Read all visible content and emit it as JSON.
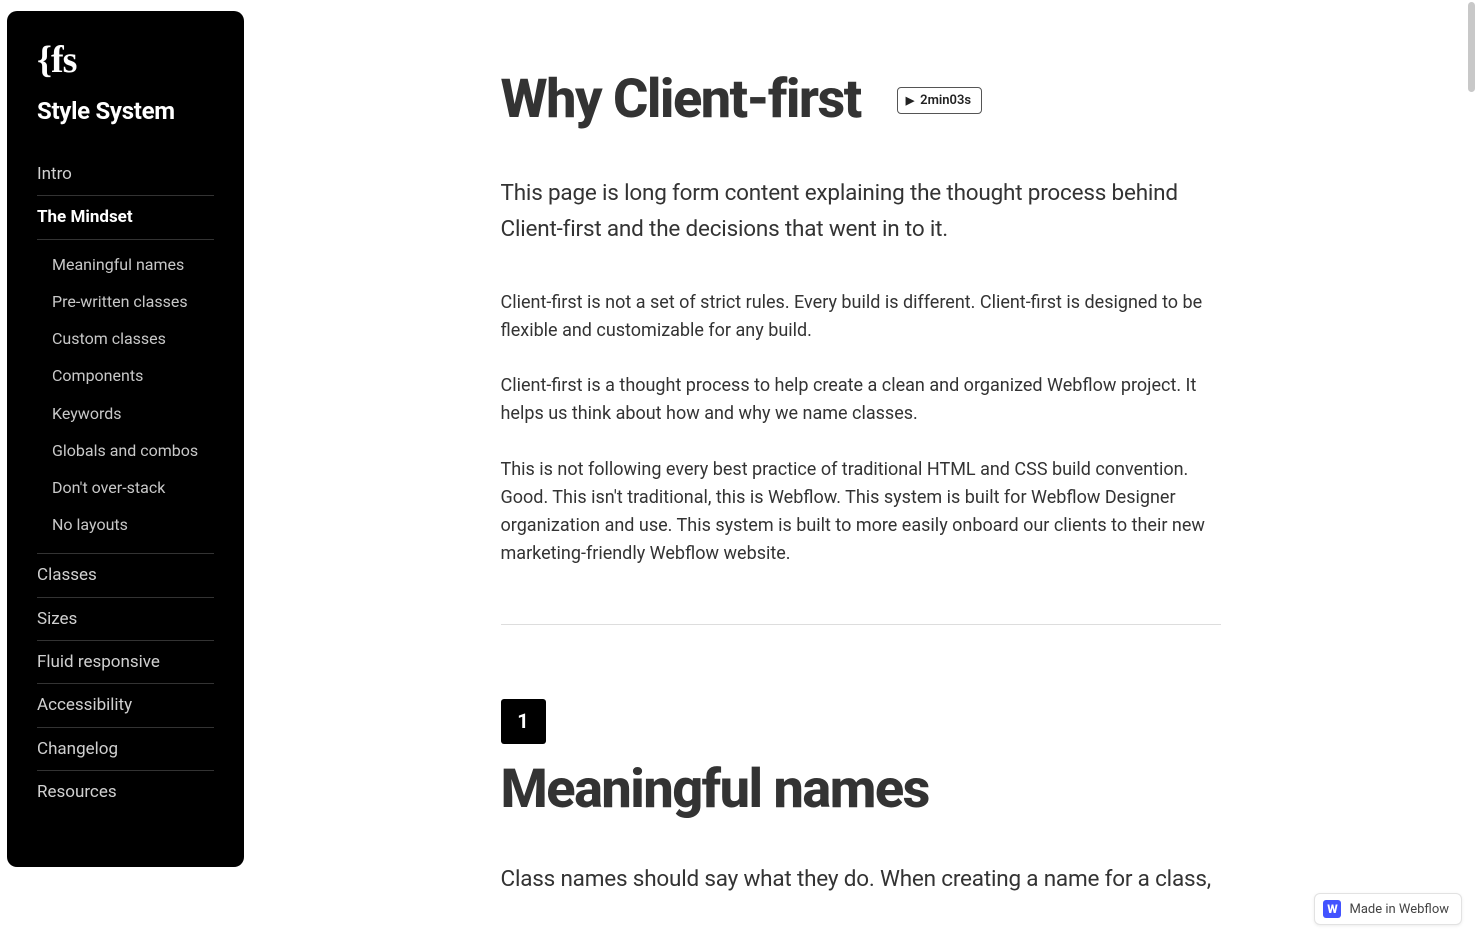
{
  "sidebar": {
    "logo": "{fs",
    "title": "Style System",
    "items": [
      {
        "label": "Intro",
        "active": false
      },
      {
        "label": "The Mindset",
        "active": true,
        "sub": [
          "Meaningful names",
          "Pre-written classes",
          "Custom classes",
          "Components",
          "Keywords",
          "Globals and combos",
          "Don't over-stack",
          "No layouts"
        ]
      },
      {
        "label": "Classes",
        "active": false
      },
      {
        "label": "Sizes",
        "active": false
      },
      {
        "label": "Fluid responsive",
        "active": false
      },
      {
        "label": "Accessibility",
        "active": false
      },
      {
        "label": "Changelog",
        "active": false
      },
      {
        "label": "Resources",
        "active": false
      }
    ]
  },
  "page": {
    "title": "Why Client-first",
    "video_chip": "2min03s",
    "lead": "This page is long form content explaining the thought process behind Client-first and the decisions that went in to it.",
    "paragraphs": [
      "Client-first is not a set of strict rules. Every build is different. Client-first is designed to be flexible and customizable for any build.",
      "Client-first is a thought process to help create a clean and organized Webflow project. It helps us think about how and why we name classes.",
      "This is not following every best practice of traditional HTML and CSS build convention. Good. This isn't traditional, this is Webflow. This system is built for Webflow Designer organization and use. This system is built to more easily onboard our clients to their new marketing-friendly Webflow website."
    ],
    "section": {
      "number": "1",
      "title": "Meaningful names",
      "truncated_line": "Class names should say what they do. When creating a name for a class,"
    }
  },
  "badge": {
    "glyph": "W",
    "text": "Made in Webflow"
  }
}
